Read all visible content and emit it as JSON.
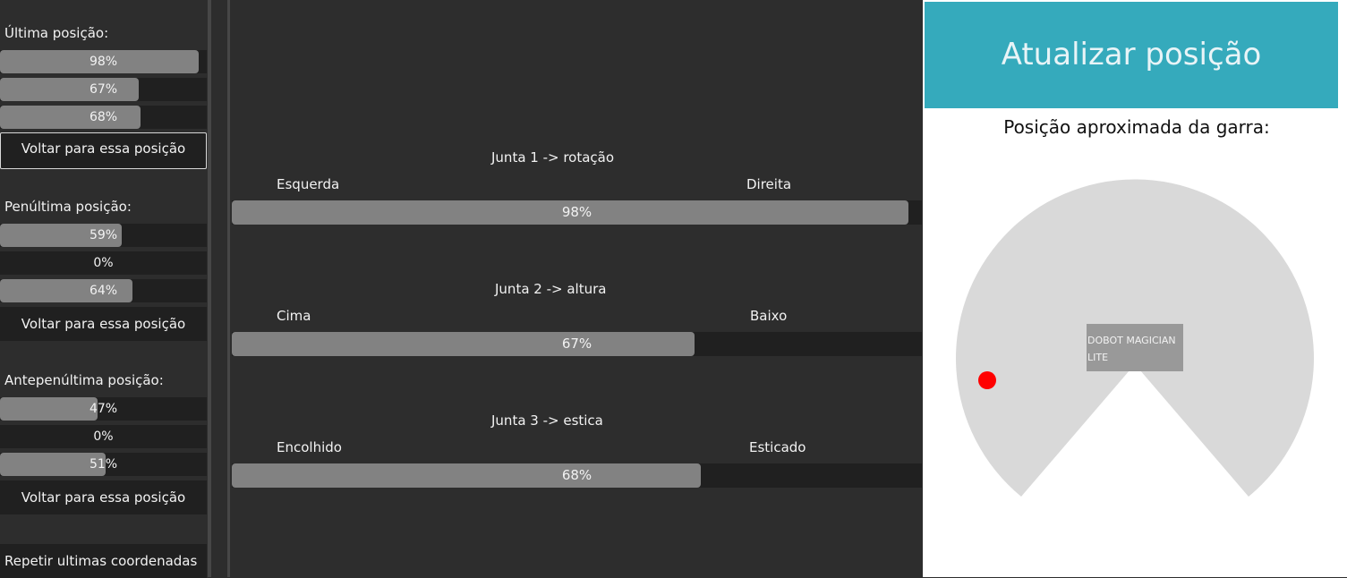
{
  "history": [
    {
      "label": "Última posição:",
      "bars": [
        {
          "text": "98%",
          "value": 0.98
        },
        {
          "text": "67%",
          "value": 0.67
        },
        {
          "text": "68%",
          "value": 0.68
        }
      ],
      "button": "Voltar para essa posição"
    },
    {
      "label": "Penúltima posição:",
      "bars": [
        {
          "text": "59%",
          "value": 0.59
        },
        {
          "text": "0%",
          "value": 0
        },
        {
          "text": "64%",
          "value": 0.64
        }
      ],
      "button": "Voltar para essa posição"
    },
    {
      "label": "Antepenúltima posição:",
      "bars": [
        {
          "text": "47%",
          "value": 0.47
        },
        {
          "text": "0%",
          "value": 0
        },
        {
          "text": "51%",
          "value": 0.51
        }
      ],
      "button": "Voltar para essa posição"
    }
  ],
  "repeat_button": "Repetir ultimas coordenadas",
  "joints": [
    {
      "title": "Junta 1 -> rotação",
      "left_label": "Esquerda",
      "right_label": "Direita",
      "text": "98%",
      "value": 0.98
    },
    {
      "title": "Junta 2 -> altura",
      "left_label": "Cima",
      "right_label": "Baixo",
      "text": "67%",
      "value": 0.67
    },
    {
      "title": "Junta 3 -> estica",
      "left_label": "Encolhido",
      "right_label": "Esticado",
      "text": "68%",
      "value": 0.68
    }
  ],
  "right": {
    "update_button": "Atualizar posição",
    "position_title": "Posição aproximada da garra:",
    "robot_label_line1": "DOBOT MAGICIAN",
    "robot_label_line2": "LITE"
  },
  "colors": {
    "accent": "#35aabc",
    "bar_fill": "#828282",
    "bar_track": "#202020",
    "background": "#2d2d2d",
    "marker": "#ff0000",
    "workspace": "#d9d9d9"
  }
}
